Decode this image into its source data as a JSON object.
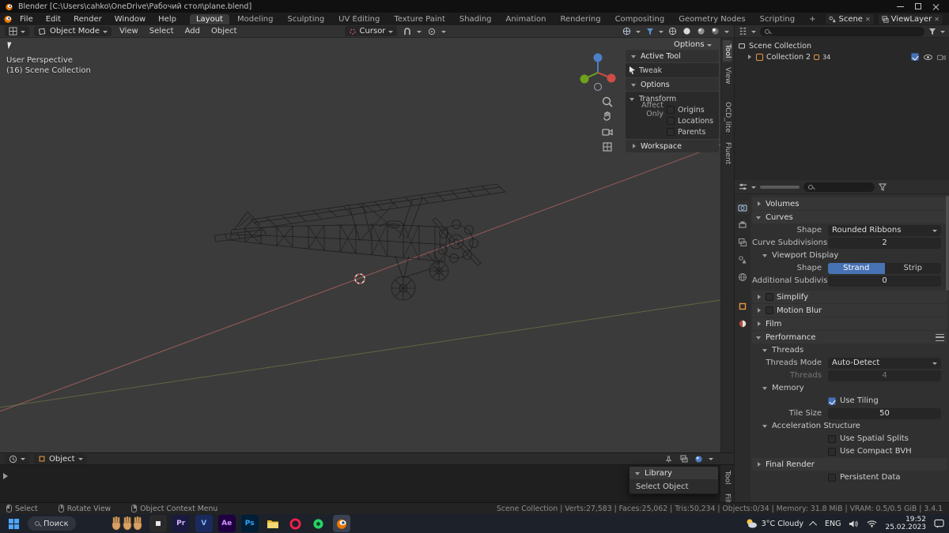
{
  "window": {
    "title": "Blender [C:\\Users\\cahko\\OneDrive\\Рабочий стол\\plane.blend]"
  },
  "topbar": {
    "menus": [
      "File",
      "Edit",
      "Render",
      "Window",
      "Help"
    ],
    "workspaces": [
      "Layout",
      "Modeling",
      "Sculpting",
      "UV Editing",
      "Texture Paint",
      "Shading",
      "Animation",
      "Rendering",
      "Compositing",
      "Geometry Nodes",
      "Scripting",
      "+"
    ],
    "scene_label": "Scene",
    "viewlayer_label": "ViewLayer"
  },
  "viewport": {
    "mode": "Object Mode",
    "menus": [
      "View",
      "Select",
      "Add",
      "Object"
    ],
    "cursor": "Cursor",
    "options_label": "Options",
    "overlay": [
      "User Perspective",
      "(16) Scene Collection"
    ],
    "sidebar_tabs": [
      "Tool",
      "View",
      "OCD_lite",
      "Fluent"
    ]
  },
  "tool_panel": {
    "active_tool_header": "Active Tool",
    "tool_name": "Tweak",
    "options_header": "Options",
    "transform_header": "Transform",
    "affect_only_label": "Affect Only",
    "origins": "Origins",
    "locations": "Locations",
    "parents": "Parents",
    "workspace_header": "Workspace"
  },
  "outliner": {
    "root_item": "Scene Collection",
    "collection_item": "Collection 2",
    "collection_badge": "34"
  },
  "properties": {
    "volumes_header": "Volumes",
    "curves_header": "Curves",
    "shape_label": "Shape",
    "shape_value": "Rounded Ribbons",
    "curve_subdiv_label": "Curve Subdivisions",
    "curve_subdiv_value": "2",
    "viewport_display_header": "Viewport Display",
    "vd_shape_label": "Shape",
    "strand_label": "Strand",
    "strip_label": "Strip",
    "add_subdiv_label": "Additional Subdivision",
    "add_subdiv_value": "0",
    "simplify_header": "Simplify",
    "motion_blur_header": "Motion Blur",
    "film_header": "Film",
    "performance_header": "Performance",
    "threads_header": "Threads",
    "threads_mode_label": "Threads Mode",
    "threads_mode_value": "Auto-Detect",
    "threads_label": "Threads",
    "threads_value": "4",
    "memory_header": "Memory",
    "use_tiling_label": "Use Tiling",
    "tile_size_label": "Tile Size",
    "tile_size_value": "50",
    "accel_header": "Acceleration Structure",
    "spatial_splits_label": "Use Spatial Splits",
    "compact_bvh_label": "Use Compact BVH",
    "final_render_header": "Final Render",
    "persistent_data_label": "Persistent Data"
  },
  "bottom_editor": {
    "object_selector": "Object",
    "sidebar_tabs": [
      "Tool",
      "Filter"
    ],
    "popup": {
      "header": "Library",
      "item": "Select Object"
    }
  },
  "status_bar": {
    "hints": [
      "Select",
      "Rotate View",
      "Object Context Menu"
    ],
    "stats": "Scene Collection  |  Verts:27,583 | Faces:25,062 | Tris:50,234 | Objects:0/34 | Memory: 31.8 MiB | VRAM: 0.5/0.5 GiB  |  3.4.1"
  },
  "taskbar": {
    "search_label": "Поиск",
    "app_letters": {
      "pr": "Pr",
      "v": "V",
      "ae": "Ae",
      "ps": "Ps"
    },
    "weather": "3°C Cloudy",
    "language": "ENG",
    "time": "19:52",
    "date": "25.02.2023"
  },
  "colors": {
    "accent_blue": "#4772b3",
    "blender_orange": "#ea7600"
  }
}
